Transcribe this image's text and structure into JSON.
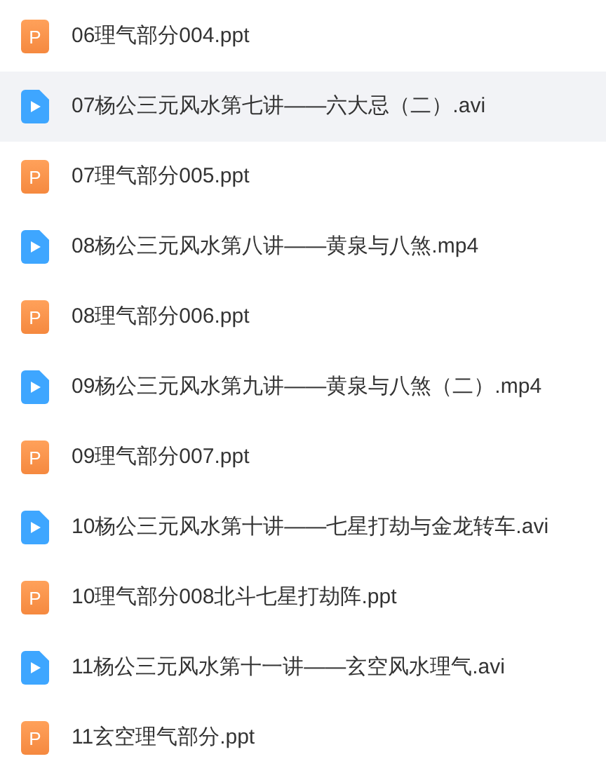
{
  "files": [
    {
      "kind": "ppt",
      "badge": "P",
      "name": "06理气部分004.ppt",
      "selected": false
    },
    {
      "kind": "video",
      "name": "07杨公三元风水第七讲——六大忌（二）.avi",
      "selected": true
    },
    {
      "kind": "ppt",
      "badge": "P",
      "name": "07理气部分005.ppt",
      "selected": false
    },
    {
      "kind": "video",
      "name": "08杨公三元风水第八讲——黄泉与八煞.mp4",
      "selected": false
    },
    {
      "kind": "ppt",
      "badge": "P",
      "name": "08理气部分006.ppt",
      "selected": false
    },
    {
      "kind": "video",
      "name": "09杨公三元风水第九讲——黄泉与八煞（二）.mp4",
      "selected": false
    },
    {
      "kind": "ppt",
      "badge": "P",
      "name": "09理气部分007.ppt",
      "selected": false
    },
    {
      "kind": "video",
      "name": "10杨公三元风水第十讲——七星打劫与金龙转车.avi",
      "selected": false
    },
    {
      "kind": "ppt",
      "badge": "P",
      "name": "10理气部分008北斗七星打劫阵.ppt",
      "selected": false
    },
    {
      "kind": "video",
      "name": "11杨公三元风水第十一讲——玄空风水理气.avi",
      "selected": false
    },
    {
      "kind": "ppt",
      "badge": "P",
      "name": "11玄空理气部分.ppt",
      "selected": false
    }
  ]
}
